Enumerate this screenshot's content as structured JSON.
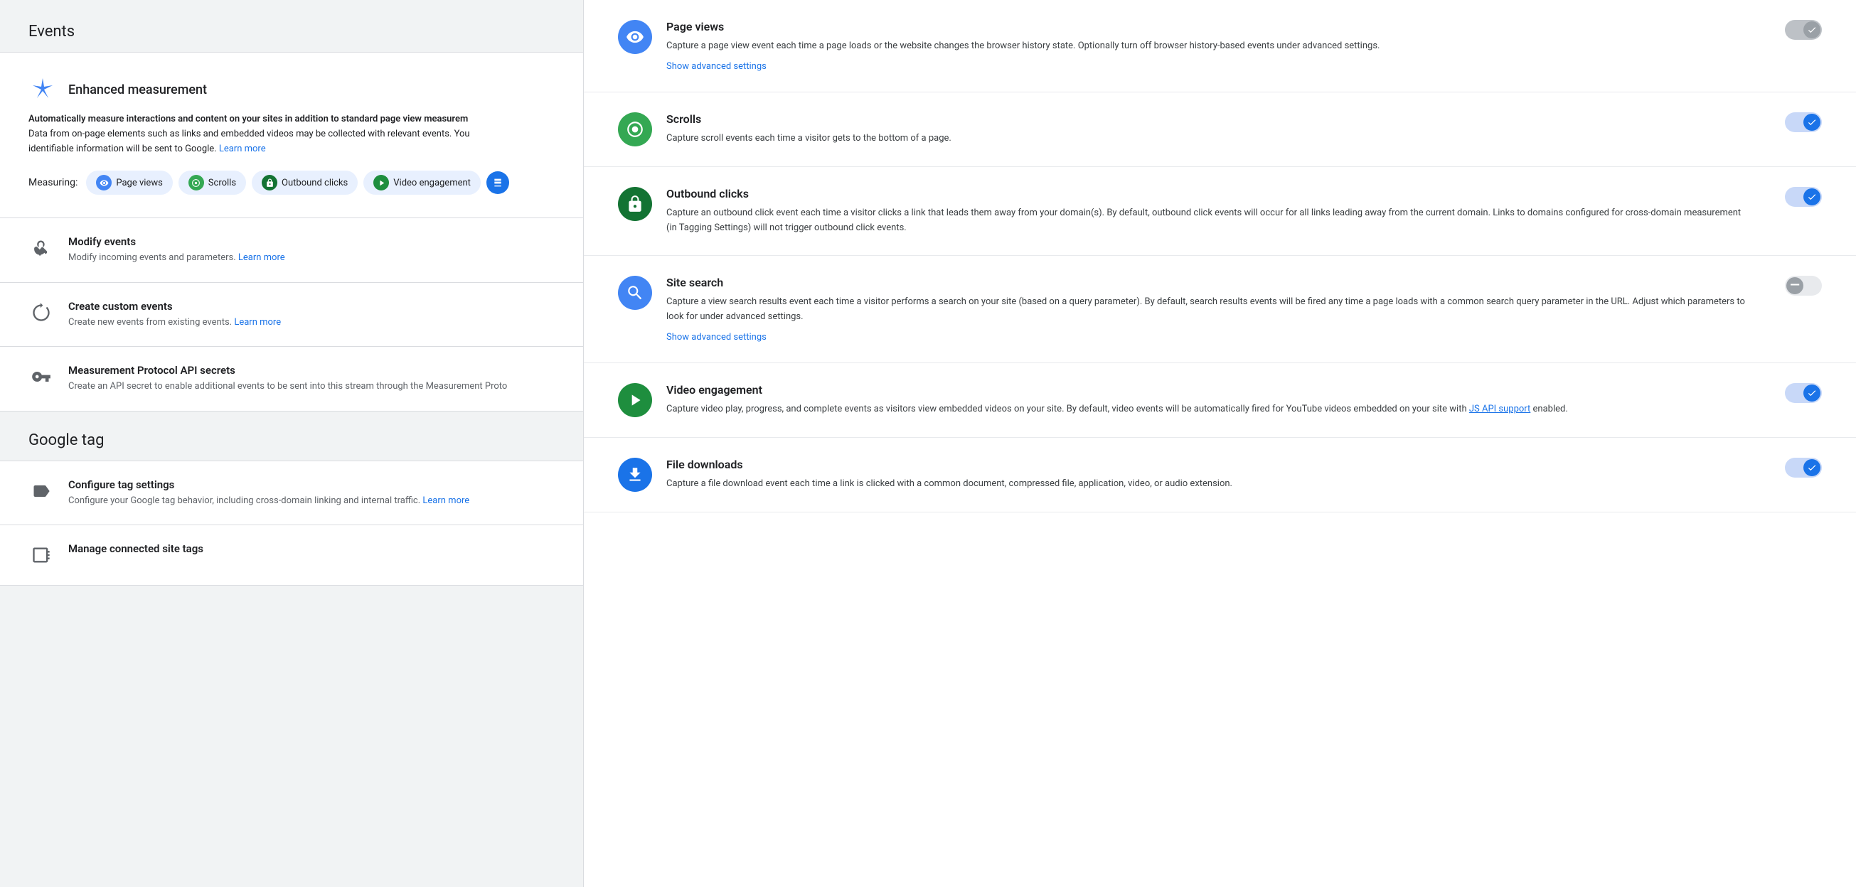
{
  "left": {
    "events_header": "Events",
    "enhanced": {
      "title": "Enhanced measurement",
      "desc_bold": "Automatically measure interactions and content on your sites in addition to standard page view measurem",
      "desc_normal": "Data from on-page elements such as links and embedded videos may be collected with relevant events. You\nidentifiable information will be sent to Google.",
      "learn_more": "Learn more",
      "measuring_label": "Measuring:",
      "chips": [
        {
          "label": "Page views",
          "icon_type": "eye",
          "color": "blue"
        },
        {
          "label": "Scrolls",
          "icon_type": "scroll",
          "color": "green"
        },
        {
          "label": "Outbound clicks",
          "icon_type": "lock",
          "color": "teal"
        },
        {
          "label": "Video engagement",
          "icon_type": "play",
          "color": "playgreen"
        }
      ],
      "more_chip": "↓"
    },
    "menu_items": [
      {
        "icon": "hand",
        "title": "Modify events",
        "desc": "Modify incoming events and parameters.",
        "link": "Learn more"
      },
      {
        "icon": "sparkle",
        "title": "Create custom events",
        "desc": "Create new events from existing events.",
        "link": "Learn more"
      },
      {
        "icon": "key",
        "title": "Measurement Protocol API secrets",
        "desc": "Create an API secret to enable additional events to be sent into this stream through the Measurement Proto"
      }
    ],
    "google_tag_header": "Google tag",
    "google_tag_items": [
      {
        "icon": "tag",
        "title": "Configure tag settings",
        "desc": "Configure your Google tag behavior, including cross-domain linking and internal traffic.",
        "link": "Learn more"
      },
      {
        "icon": "connected",
        "title": "Manage connected site tags"
      }
    ]
  },
  "right": {
    "features": [
      {
        "id": "page_views",
        "title": "Page views",
        "icon_type": "eye",
        "icon_color": "blue",
        "desc": "Capture a page view event each time a page loads or the website changes the browser history state. Optionally turn off browser history-based events under advanced settings.",
        "show_advanced": "Show advanced settings",
        "toggle_state": "disabled_on"
      },
      {
        "id": "scrolls",
        "title": "Scrolls",
        "icon_type": "scroll",
        "icon_color": "green",
        "desc": "Capture scroll events each time a visitor gets to the bottom of a page.",
        "toggle_state": "on"
      },
      {
        "id": "outbound_clicks",
        "title": "Outbound clicks",
        "icon_type": "lock",
        "icon_color": "darkgreen",
        "desc": "Capture an outbound click event each time a visitor clicks a link that leads them away from your domain(s). By default, outbound click events will occur for all links leading away from the current domain. Links to domains configured for cross-domain measurement (in Tagging Settings) will not trigger outbound click events.",
        "toggle_state": "on"
      },
      {
        "id": "site_search",
        "title": "Site search",
        "icon_type": "search",
        "icon_color": "blue",
        "desc": "Capture a view search results event each time a visitor performs a search on your site (based on a query parameter). By default, search results events will be fired any time a page loads with a common search query parameter in the URL. Adjust which parameters to look for under advanced settings.",
        "show_advanced": "Show advanced settings",
        "toggle_state": "disabled_off"
      },
      {
        "id": "video_engagement",
        "title": "Video engagement",
        "icon_type": "play",
        "icon_color": "playgreen",
        "desc_before_link": "Capture video play, progress, and complete events as visitors view embedded videos on your site. By default, video events will be automatically fired for YouTube videos embedded on your site with ",
        "link_text": "JS API support",
        "desc_after_link": " enabled.",
        "toggle_state": "on"
      },
      {
        "id": "file_downloads",
        "title": "File downloads",
        "icon_type": "download",
        "icon_color": "darkblue",
        "desc": "Capture a file download event each time a link is clicked with a common document, compressed file, application, video, or audio extension.",
        "toggle_state": "on"
      }
    ]
  }
}
